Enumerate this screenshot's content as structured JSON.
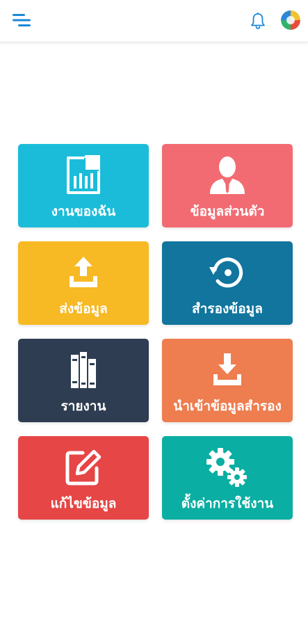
{
  "header": {
    "menu_icon": "menu-icon",
    "bell_icon": "bell-icon",
    "avatar_icon": "avatar-icon"
  },
  "tiles": [
    {
      "label": "งานของฉัน",
      "icon": "document-chart-icon",
      "color": "#1bbcd9"
    },
    {
      "label": "ข้อมูลส่วนตัว",
      "icon": "person-icon",
      "color": "#f26b72"
    },
    {
      "label": "ส่งข้อมูล",
      "icon": "upload-icon",
      "color": "#f7b924"
    },
    {
      "label": "สำรองข้อมูล",
      "icon": "restore-icon",
      "color": "#11759e"
    },
    {
      "label": "รายงาน",
      "icon": "books-icon",
      "color": "#2e3d51"
    },
    {
      "label": "นำเข้าข้อมูลสำรอง",
      "icon": "download-icon",
      "color": "#ee7d4f"
    },
    {
      "label": "แก้ไขข้อมูล",
      "icon": "edit-icon",
      "color": "#e64646"
    },
    {
      "label": "ตั้งค่าการใช้งาน",
      "icon": "gears-icon",
      "color": "#0aaea2"
    }
  ]
}
